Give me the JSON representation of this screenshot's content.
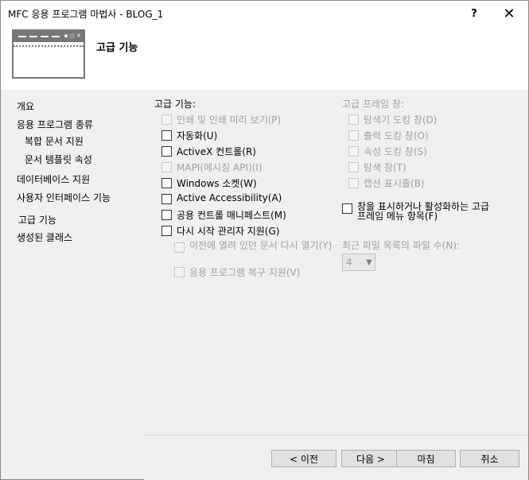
{
  "window": {
    "title": "MFC 응용 프로그램 마법사 - BLOG_1",
    "help": "?",
    "close": "✕"
  },
  "header": {
    "title": "고급 기능"
  },
  "nav": [
    {
      "label": "개요"
    },
    {
      "label": "응용 프로그램 종류"
    },
    {
      "label": "복합 문서 지원"
    },
    {
      "label": "문서 템플릿 속성"
    },
    {
      "label": "데이터베이스 지원"
    },
    {
      "label": "사용자 인터페이스 기능"
    },
    {
      "label": "고급 기능"
    },
    {
      "label": "생성된 클래스"
    }
  ],
  "advanced": {
    "label": "고급 기능:",
    "options": [
      {
        "label": "인쇄 및 인쇄 미리 보기(P)",
        "enabled": false,
        "checked": false
      },
      {
        "label": "자동화(U)",
        "enabled": true,
        "checked": false
      },
      {
        "label": "ActiveX 컨트롤(R)",
        "enabled": true,
        "checked": false
      },
      {
        "label": "MAPI(메시징 API)(I)",
        "enabled": false,
        "checked": false
      },
      {
        "label": "Windows 소켓(W)",
        "enabled": true,
        "checked": false
      },
      {
        "label": "Active Accessibility(A)",
        "enabled": true,
        "checked": false
      },
      {
        "label": "공용 컨트롤 매니페스트(M)",
        "enabled": true,
        "checked": false
      },
      {
        "label": "다시 시작 관리자 지원(G)",
        "enabled": true,
        "checked": false
      }
    ],
    "sub_options": [
      {
        "label": "이전에 열려 있던 문서 다시 열기(Y)",
        "enabled": false,
        "checked": false
      },
      {
        "label": "응용 프로그램 복구 지원(V)",
        "enabled": false,
        "checked": false
      }
    ]
  },
  "frame_panes": {
    "label": "고급 프레임 창:",
    "options": [
      {
        "label": "탐색기 도킹 창(D)",
        "enabled": false,
        "checked": false
      },
      {
        "label": "출력 도킹 창(O)",
        "enabled": false,
        "checked": false
      },
      {
        "label": "속성 도킹 창(S)",
        "enabled": false,
        "checked": false
      },
      {
        "label": "탐색 창(T)",
        "enabled": false,
        "checked": false
      },
      {
        "label": "캡션 표시줄(B)",
        "enabled": false,
        "checked": false
      }
    ],
    "menu_option": {
      "label": "창을 표시하거나 활성화하는 고급 프레임 메뉴 항목(F)",
      "enabled": true,
      "checked": false
    }
  },
  "recent_files": {
    "label": "최근 파일 목록의 파일 수(N):",
    "value": "4"
  },
  "buttons": {
    "prev": "< 이전",
    "next": "다음 >",
    "finish": "마침",
    "cancel": "취소"
  }
}
